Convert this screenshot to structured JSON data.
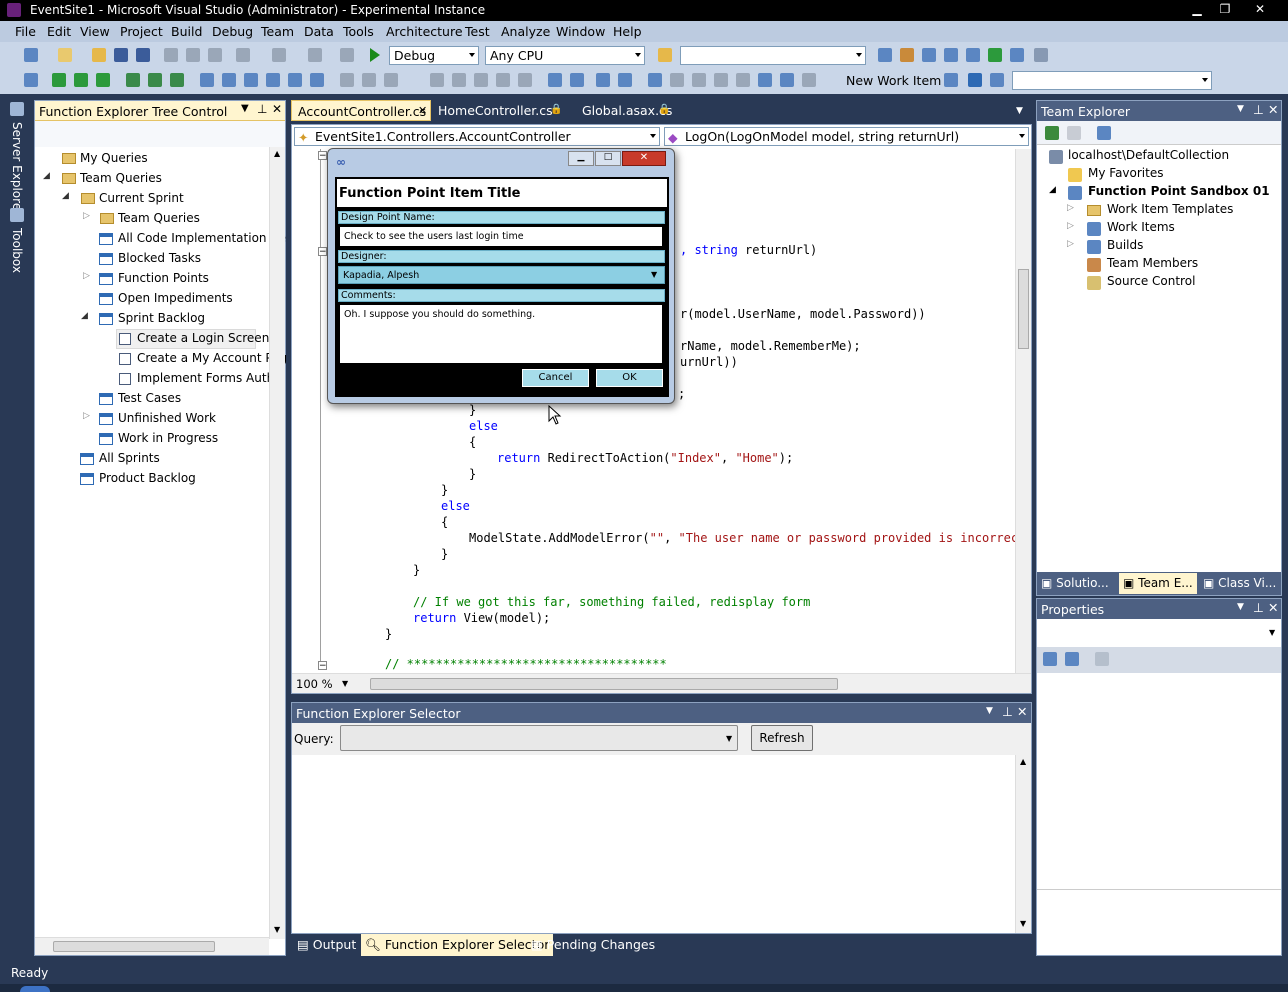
{
  "window": {
    "title": "EventSite1 - Microsoft Visual Studio (Administrator) - Experimental Instance",
    "minimize": "▁",
    "restore": "❐",
    "close": "✕"
  },
  "menu": [
    "File",
    "Edit",
    "View",
    "Project",
    "Build",
    "Debug",
    "Team",
    "Data",
    "Tools",
    "Architecture",
    "Test",
    "Analyze",
    "Window",
    "Help"
  ],
  "toolbar": {
    "config": "Debug",
    "platform": "Any CPU",
    "search": "",
    "new_work_item": "New Work Item",
    "find": ""
  },
  "side_tabs": {
    "server_explorer": "Server Explorer",
    "toolbox": "Toolbox"
  },
  "fe_tree": {
    "title": "Function Explorer Tree Control",
    "items": [
      {
        "label": "My Queries",
        "icon": "folder-icon"
      },
      {
        "label": "Team Queries",
        "icon": "folder-icon"
      },
      {
        "label": "Current Sprint",
        "icon": "folder-icon"
      },
      {
        "label": "Team Queries",
        "icon": "folder-icon"
      },
      {
        "label": "All Code Implementation Ite",
        "icon": "query-icon"
      },
      {
        "label": "Blocked Tasks",
        "icon": "query-icon"
      },
      {
        "label": "Function Points",
        "icon": "query-icon"
      },
      {
        "label": "Open Impediments",
        "icon": "query-icon"
      },
      {
        "label": "Sprint Backlog",
        "icon": "query-icon"
      },
      {
        "label": "Create a Login Screen",
        "icon": "work-item-icon"
      },
      {
        "label": "Create a My Account Pag",
        "icon": "work-item-icon"
      },
      {
        "label": "Implement Forms Authe",
        "icon": "work-item-icon"
      },
      {
        "label": "Test Cases",
        "icon": "query-icon"
      },
      {
        "label": "Unfinished Work",
        "icon": "query-icon"
      },
      {
        "label": "Work in Progress",
        "icon": "query-icon"
      },
      {
        "label": "All Sprints",
        "icon": "query-icon"
      },
      {
        "label": "Product Backlog",
        "icon": "query-icon"
      }
    ]
  },
  "editor": {
    "tabs": [
      "AccountController.cs",
      "HomeController.cs",
      "Global.asax.cs"
    ],
    "class_nav": "EventSite1.Controllers.AccountController",
    "member_nav": "LogOn(LogOnModel model, string returnUrl)",
    "zoom": "100 %",
    "code": {
      "l1": ", string returnUrl)",
      "l2": "r(model.UserName, model.Password))",
      "l3": "rName, model.RememberMe);",
      "l4": "urnUrl))",
      "l5": ";",
      "l6": "}",
      "l7": "else",
      "l8": "{",
      "l9a": "return ",
      "l9b": "RedirectToAction(",
      "l9c": "\"Index\"",
      ", ": ", ",
      "l9d": "\"Home\"",
      "l9e": ");",
      "l10": "}",
      "l11": "}",
      "l12": "else",
      "l13": "{",
      "l14a": "ModelState.AddModelError(",
      "l14b": "\"\"",
      "l14c": ", ",
      "l14d": "\"The user name or password provided is incorrect.",
      "l15": "}",
      "l16": "}",
      "l17": "// If we got this far, something failed, redisplay form",
      "l18a": "return ",
      "l18b": "View(model);",
      "l19": "}",
      "l20": "// ************************************"
    }
  },
  "dialog": {
    "heading": "Function Point Item Title",
    "design_label": "Design Point Name:",
    "design_value": "Check to see the users last login time",
    "designer_label": "Designer:",
    "designer_value": "Kapadia, Alpesh",
    "comments_label": "Comments:",
    "comments_value": "Oh.  I suppose you should do something.",
    "cancel": "Cancel",
    "ok": "OK"
  },
  "team_explorer": {
    "title": "Team Explorer",
    "server": "localhost\\DefaultCollection",
    "items": [
      "My Favorites",
      "Function Point Sandbox 01",
      "Work Item Templates",
      "Work Items",
      "Builds",
      "Team Members",
      "Source Control"
    ],
    "bottom_tabs": [
      "Solutio...",
      "Team E...",
      "Class Vi..."
    ]
  },
  "properties": {
    "title": "Properties"
  },
  "selector": {
    "title": "Function Explorer Selector",
    "query_label": "Query:",
    "query_value": "",
    "refresh": "Refresh"
  },
  "bottom_tabs": [
    "Output",
    "Function Explorer Selector",
    "Pending Changes"
  ],
  "status": {
    "text": "Ready"
  }
}
